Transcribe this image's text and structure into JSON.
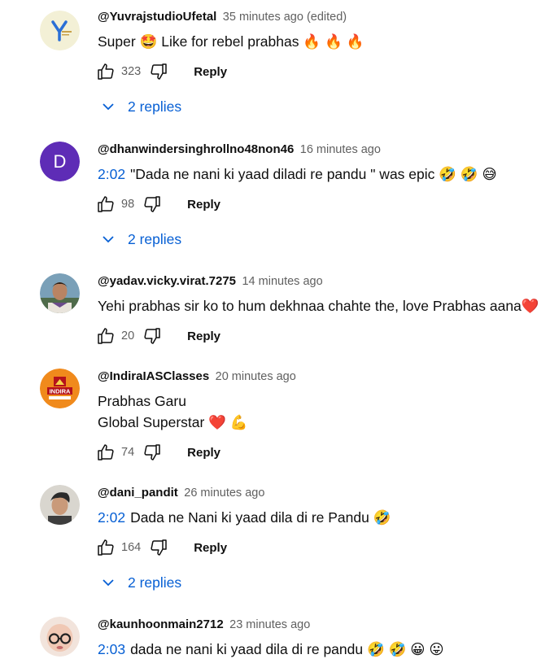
{
  "comments": [
    {
      "handle": "@YuvrajstudioUfetal",
      "time": "35 minutes ago (edited)",
      "lines": [
        {
          "ts": "",
          "text": "Super 🤩 Like for rebel prabhas 🔥 🔥 🔥"
        }
      ],
      "likes": "323",
      "reply_label": "Reply",
      "replies_label": "2 replies",
      "avatar": {
        "type": "logo",
        "letter": "Y",
        "bg": "#f3f0d6",
        "color": "#2a6fd6"
      }
    },
    {
      "handle": "@dhanwindersinghrollno48non46",
      "time": "16 minutes ago",
      "lines": [
        {
          "ts": "2:02",
          "text": "\"Dada ne nani ki yaad diladi re pandu \" was epic 🤣 🤣 😅"
        }
      ],
      "likes": "98",
      "reply_label": "Reply",
      "replies_label": "2 replies",
      "avatar": {
        "type": "letter",
        "letter": "D",
        "bg": "#5e2cb6",
        "color": "#ffffff"
      }
    },
    {
      "handle": "@yadav.vicky.virat.7275",
      "time": "14 minutes ago",
      "lines": [
        {
          "ts": "",
          "text": "Yehi prabhas sir ko to hum dekhnaa chahte the,  love Prabhas aana❤️"
        }
      ],
      "likes": "20",
      "reply_label": "Reply",
      "replies_label": "",
      "avatar": {
        "type": "photo",
        "bg": "#7aa0b8",
        "color": "#3b2a1e"
      }
    },
    {
      "handle": "@IndiraIASClasses",
      "time": "20 minutes ago",
      "lines": [
        {
          "ts": "",
          "text": "Prabhas Garu"
        },
        {
          "ts": "",
          "text": "Global Superstar ❤️ 💪"
        }
      ],
      "likes": "74",
      "reply_label": "Reply",
      "replies_label": "",
      "avatar": {
        "type": "badge",
        "letter": "INDIRA",
        "bg": "#f08a1c",
        "color": "#ffffff"
      }
    },
    {
      "handle": "@dani_pandit",
      "time": "26 minutes ago",
      "lines": [
        {
          "ts": "2:02",
          "text": "Dada ne Nani ki yaad dila di re Pandu 🤣"
        }
      ],
      "likes": "164",
      "reply_label": "Reply",
      "replies_label": "2 replies",
      "avatar": {
        "type": "photo",
        "bg": "#d9d6cf",
        "color": "#2a2a2a"
      }
    },
    {
      "handle": "@kaunhoonmain2712",
      "time": "23 minutes ago",
      "lines": [
        {
          "ts": "2:03",
          "text": "dada ne nani ki yaad dila di re pandu 🤣 🤣 😀 😛"
        }
      ],
      "likes": "",
      "reply_label": "",
      "replies_label": "",
      "avatar": {
        "type": "baby",
        "bg": "#f2e4dc",
        "color": "#333333"
      }
    }
  ],
  "colors": {
    "link": "#065fd4",
    "meta": "#606060",
    "text": "#0f0f0f"
  }
}
